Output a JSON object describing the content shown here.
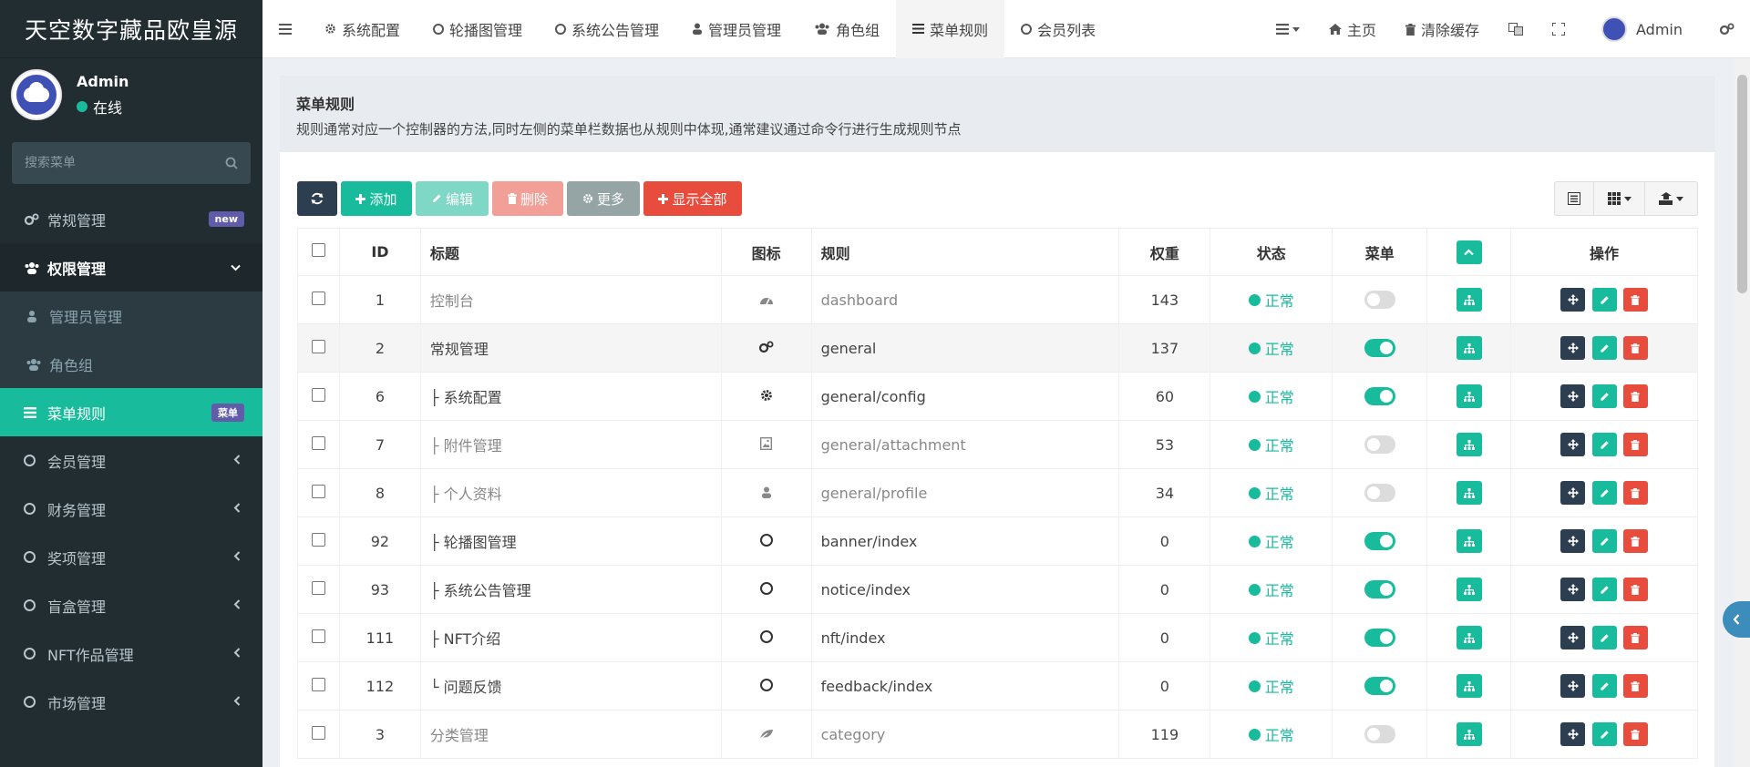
{
  "brand": "天空数字藏品欧皇源",
  "user": {
    "name": "Admin",
    "status": "在线"
  },
  "search": {
    "placeholder": "搜索菜单"
  },
  "sidebar": {
    "items": [
      {
        "label": "常规管理",
        "badge": "new"
      },
      {
        "label": "权限管理"
      },
      {
        "label": "管理员管理"
      },
      {
        "label": "角色组"
      },
      {
        "label": "菜单规则",
        "badge": "菜单"
      },
      {
        "label": "会员管理"
      },
      {
        "label": "财务管理"
      },
      {
        "label": "奖项管理"
      },
      {
        "label": "盲盒管理"
      },
      {
        "label": "NFT作品管理"
      },
      {
        "label": "市场管理"
      }
    ]
  },
  "topnav": {
    "tabs": [
      "系统配置",
      "轮播图管理",
      "系统公告管理",
      "管理员管理",
      "角色组",
      "菜单规则",
      "会员列表"
    ],
    "home": "主页",
    "clear_cache": "清除缓存",
    "admin": "Admin"
  },
  "panel": {
    "title": "菜单规则",
    "desc": "规则通常对应一个控制器的方法,同时左侧的菜单栏数据也从规则中体现,通常建议通过命令行进行生成规则节点"
  },
  "toolbar": {
    "add": "添加",
    "edit": "编辑",
    "delete": "删除",
    "more": "更多",
    "show_all": "显示全部"
  },
  "table": {
    "headers": {
      "id": "ID",
      "title": "标题",
      "icon": "图标",
      "rule": "规则",
      "weight": "权重",
      "status": "状态",
      "menu": "菜单",
      "ops": "操作"
    },
    "rows": [
      {
        "id": "1",
        "title": "控制台",
        "rule": "dashboard",
        "weight": "143",
        "status": "正常",
        "icon": "dashboard-icon"
      },
      {
        "id": "2",
        "title": "常规管理",
        "rule": "general",
        "weight": "137",
        "status": "正常",
        "icon": "cogs-icon"
      },
      {
        "id": "6",
        "title": "├ 系统配置",
        "rule": "general/config",
        "weight": "60",
        "status": "正常",
        "icon": "cog-icon"
      },
      {
        "id": "7",
        "title": "├ 附件管理",
        "rule": "general/attachment",
        "weight": "53",
        "status": "正常",
        "icon": "image-icon"
      },
      {
        "id": "8",
        "title": "├ 个人资料",
        "rule": "general/profile",
        "weight": "34",
        "status": "正常",
        "icon": "user-icon"
      },
      {
        "id": "92",
        "title": "├ 轮播图管理",
        "rule": "banner/index",
        "weight": "0",
        "status": "正常",
        "icon": "circle-icon"
      },
      {
        "id": "93",
        "title": "├ 系统公告管理",
        "rule": "notice/index",
        "weight": "0",
        "status": "正常",
        "icon": "circle-icon"
      },
      {
        "id": "111",
        "title": "├ NFT介绍",
        "rule": "nft/index",
        "weight": "0",
        "status": "正常",
        "icon": "circle-icon"
      },
      {
        "id": "112",
        "title": "└ 问题反馈",
        "rule": "feedback/index",
        "weight": "0",
        "status": "正常",
        "icon": "circle-icon"
      },
      {
        "id": "3",
        "title": "分类管理",
        "rule": "category",
        "weight": "119",
        "status": "正常",
        "icon": "leaf-icon"
      }
    ]
  },
  "colors": {
    "accent": "#18bc9c",
    "sidebar": "#222d32",
    "danger": "#e74c3c",
    "dark": "#2c3e50"
  }
}
